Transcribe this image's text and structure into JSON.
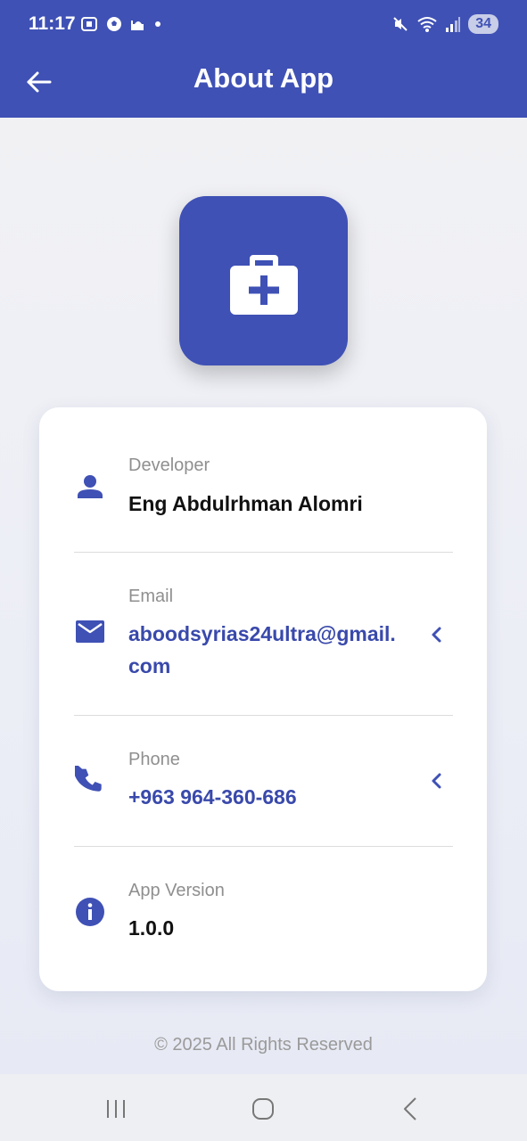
{
  "status_bar": {
    "time": "11:17",
    "battery": "34"
  },
  "app_bar": {
    "title": "About App"
  },
  "info": [
    {
      "label": "Developer",
      "value": "Eng Abdulrhman Alomri",
      "icon": "person-icon"
    },
    {
      "label": "Email",
      "value_line1": "aboodsyrias24ultra@gmail.",
      "value_line2": "com",
      "icon": "email-icon"
    },
    {
      "label": "Phone",
      "value": "+963 964-360-686",
      "icon": "phone-icon"
    },
    {
      "label": "App Version",
      "value": "1.0.0",
      "icon": "info-icon"
    }
  ],
  "footer": "© 2025 All Rights Reserved",
  "colors": {
    "primary": "#3f51b5",
    "link": "#3949ab"
  }
}
